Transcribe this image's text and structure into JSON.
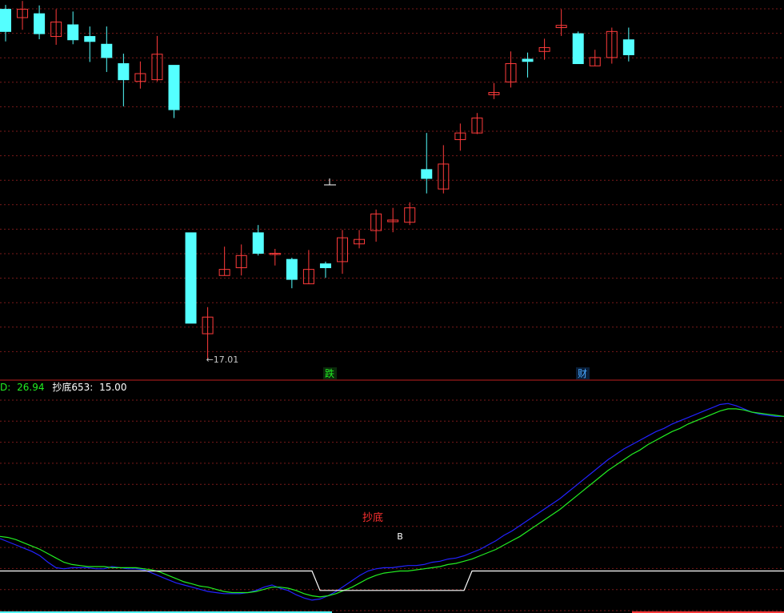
{
  "colors": {
    "background": "#000000",
    "up": "#ff3b3b",
    "down": "#54ffff",
    "grid": "#7a1a1a",
    "divider": "#c02020",
    "line_blue": "#2222ff",
    "line_green": "#22ee22",
    "line_white": "#ffffff",
    "label_red": "#ff3030"
  },
  "upper_panel": {
    "low_marker": "←17.01",
    "event_tags": [
      {
        "text": "跌",
        "color": "#22ee22"
      },
      {
        "text": "财",
        "color": "#4aa8ff"
      }
    ]
  },
  "lower_panel": {
    "header": {
      "prefix": "D:",
      "value1": "26.94",
      "indicator_label": "抄底653:",
      "indicator_value": "15.00"
    },
    "signal_label": "抄底",
    "buy_marker": "B"
  },
  "chart_data": [
    {
      "type": "candlestick",
      "title": "",
      "candles": [
        {
          "o": 23.32,
          "c": 22.92,
          "h": 23.4,
          "l": 22.74
        },
        {
          "o": 23.17,
          "c": 23.32,
          "h": 23.47,
          "l": 22.95
        },
        {
          "o": 23.24,
          "c": 22.88,
          "h": 23.39,
          "l": 22.78
        },
        {
          "o": 22.83,
          "c": 23.09,
          "h": 23.32,
          "l": 22.68
        },
        {
          "o": 23.04,
          "c": 22.77,
          "h": 23.28,
          "l": 22.69
        },
        {
          "o": 22.83,
          "c": 22.74,
          "h": 23.01,
          "l": 22.37
        },
        {
          "o": 22.69,
          "c": 22.45,
          "h": 23.01,
          "l": 22.19
        },
        {
          "o": 22.34,
          "c": 22.05,
          "h": 22.52,
          "l": 21.57
        },
        {
          "o": 22.02,
          "c": 22.16,
          "h": 22.38,
          "l": 21.89
        },
        {
          "o": 22.05,
          "c": 22.51,
          "h": 22.84,
          "l": 22.02
        },
        {
          "o": 22.31,
          "c": 21.51,
          "h": 22.31,
          "l": 21.36
        },
        {
          "o": 19.29,
          "c": 17.66,
          "h": 19.29,
          "l": 17.66
        },
        {
          "o": 17.47,
          "c": 17.77,
          "h": 17.95,
          "l": 17.01
        },
        {
          "o": 18.52,
          "c": 18.63,
          "h": 19.04,
          "l": 18.52
        },
        {
          "o": 18.66,
          "c": 18.88,
          "h": 19.08,
          "l": 18.52
        },
        {
          "o": 19.29,
          "c": 18.92,
          "h": 19.43,
          "l": 18.88
        },
        {
          "o": 18.92,
          "c": 18.92,
          "h": 19.0,
          "l": 18.7
        },
        {
          "o": 18.81,
          "c": 18.45,
          "h": 18.84,
          "l": 18.29
        },
        {
          "o": 18.37,
          "c": 18.63,
          "h": 18.98,
          "l": 18.37
        },
        {
          "o": 18.73,
          "c": 18.66,
          "h": 18.77,
          "l": 18.48
        },
        {
          "o": 18.77,
          "c": 19.2,
          "h": 19.34,
          "l": 18.55
        },
        {
          "o": 19.09,
          "c": 19.17,
          "h": 19.34,
          "l": 19.01
        },
        {
          "o": 19.33,
          "c": 19.63,
          "h": 19.71,
          "l": 19.13
        },
        {
          "o": 19.49,
          "c": 19.52,
          "h": 19.74,
          "l": 19.3
        },
        {
          "o": 19.48,
          "c": 19.74,
          "h": 19.84,
          "l": 19.43
        },
        {
          "o": 20.43,
          "c": 20.27,
          "h": 21.09,
          "l": 20.0
        },
        {
          "o": 20.08,
          "c": 20.53,
          "h": 20.87,
          "l": 20.0
        },
        {
          "o": 20.97,
          "c": 21.09,
          "h": 21.26,
          "l": 20.77
        },
        {
          "o": 21.09,
          "c": 21.36,
          "h": 21.45,
          "l": 21.07
        },
        {
          "o": 21.78,
          "c": 21.82,
          "h": 21.99,
          "l": 21.7
        },
        {
          "o": 22.01,
          "c": 22.34,
          "h": 22.56,
          "l": 21.91
        },
        {
          "o": 22.42,
          "c": 22.38,
          "h": 22.54,
          "l": 22.09
        },
        {
          "o": 22.56,
          "c": 22.63,
          "h": 22.79,
          "l": 22.41
        },
        {
          "o": 22.99,
          "c": 23.03,
          "h": 23.32,
          "l": 22.84
        },
        {
          "o": 22.88,
          "c": 22.34,
          "h": 22.92,
          "l": 22.34
        },
        {
          "o": 22.3,
          "c": 22.45,
          "h": 22.59,
          "l": 22.3
        },
        {
          "o": 22.45,
          "c": 22.92,
          "h": 22.99,
          "l": 22.34
        },
        {
          "o": 22.77,
          "c": 22.5,
          "h": 22.99,
          "l": 22.38
        }
      ],
      "annotation": "17.01"
    },
    {
      "type": "line",
      "title": "",
      "x": [
        0,
        1,
        2,
        3,
        4,
        5,
        6,
        7,
        8,
        9,
        10,
        11,
        12,
        13,
        14,
        15,
        16,
        17,
        18,
        19,
        20,
        21,
        22,
        23,
        24,
        25,
        26,
        27,
        28,
        29,
        30,
        31,
        32,
        33,
        34,
        35,
        36,
        37,
        38,
        39,
        40,
        41,
        42,
        43,
        44,
        45,
        46,
        47,
        48,
        49,
        50,
        51,
        52,
        53,
        54,
        55,
        56,
        57,
        58,
        59,
        60,
        61,
        62,
        63,
        64,
        65,
        66,
        67,
        68,
        69,
        70,
        71,
        72,
        73,
        74,
        75,
        76,
        77,
        78,
        79,
        80,
        81,
        82,
        83,
        84,
        85,
        86,
        87,
        88,
        89,
        90,
        91,
        92,
        93,
        94,
        95,
        96,
        97,
        98
      ],
      "series": [
        {
          "name": "",
          "color": "#2222ff",
          "values": [
            63,
            60,
            57,
            54,
            51,
            47,
            41,
            36,
            35,
            36,
            36,
            36,
            35,
            35,
            37,
            36,
            35,
            35,
            34,
            31,
            28,
            25,
            22,
            20,
            18,
            16,
            14,
            13,
            12,
            12,
            12,
            13,
            15,
            18,
            20,
            17,
            15,
            11,
            8,
            6,
            7,
            10,
            14,
            19,
            24,
            29,
            33,
            35,
            36,
            36,
            37,
            38,
            38,
            39,
            41,
            42,
            44,
            45,
            47,
            50,
            53,
            57,
            61,
            66,
            70,
            75,
            80,
            85,
            90,
            95,
            100,
            106,
            112,
            118,
            124,
            130,
            136,
            141,
            146,
            150,
            154,
            158,
            162,
            165,
            169,
            172,
            175,
            178,
            181,
            184,
            187,
            188,
            186,
            183,
            180,
            178,
            177,
            176,
            176
          ]
        },
        {
          "name": "",
          "color": "#22ee22",
          "values": [
            65,
            64,
            62,
            59,
            56,
            53,
            49,
            45,
            41,
            39,
            38,
            37,
            37,
            37,
            36,
            36,
            36,
            36,
            35,
            34,
            32,
            29,
            26,
            23,
            21,
            19,
            18,
            16,
            14,
            13,
            13,
            13,
            14,
            16,
            18,
            18,
            17,
            15,
            12,
            10,
            9,
            10,
            12,
            15,
            18,
            22,
            26,
            29,
            31,
            32,
            33,
            33,
            34,
            35,
            36,
            37,
            39,
            40,
            42,
            44,
            47,
            50,
            53,
            57,
            61,
            65,
            70,
            75,
            80,
            85,
            90,
            96,
            102,
            108,
            114,
            120,
            126,
            131,
            136,
            141,
            145,
            150,
            154,
            158,
            162,
            165,
            169,
            172,
            175,
            178,
            181,
            183,
            183,
            182,
            180,
            179,
            178,
            177,
            176
          ]
        },
        {
          "name": "",
          "color": "#ffffff",
          "values": [
            33,
            33,
            33,
            33,
            33,
            33,
            33,
            33,
            33,
            33,
            33,
            33,
            33,
            33,
            33,
            33,
            33,
            33,
            33,
            33,
            33,
            33,
            33,
            33,
            33,
            33,
            33,
            33,
            33,
            33,
            33,
            33,
            33,
            33,
            33,
            33,
            33,
            33,
            33,
            33,
            15,
            15,
            15,
            15,
            15,
            15,
            15,
            15,
            15,
            15,
            15,
            15,
            15,
            15,
            15,
            15,
            15,
            15,
            15,
            33,
            33,
            33,
            33,
            33,
            33,
            33,
            33,
            33,
            33,
            33,
            33,
            33,
            33,
            33,
            33,
            33,
            33,
            33,
            33,
            33,
            33,
            33,
            33,
            33,
            33,
            33,
            33,
            33,
            33,
            33,
            33,
            33,
            33,
            33,
            33,
            33,
            33,
            33,
            33
          ]
        }
      ],
      "ylim": [
        0,
        200
      ]
    }
  ]
}
